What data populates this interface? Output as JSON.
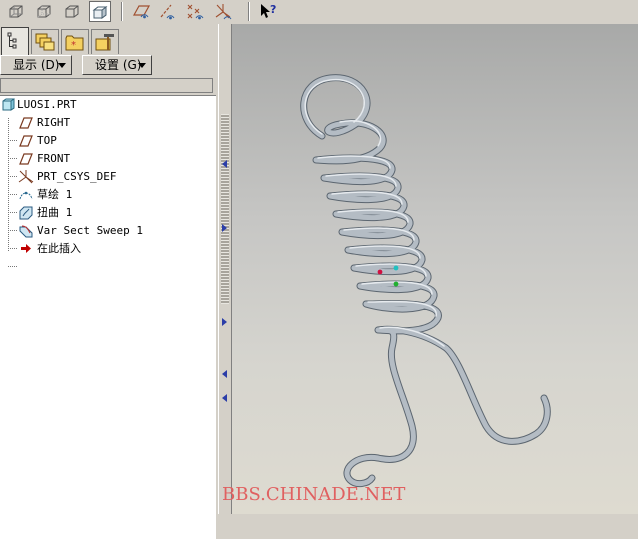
{
  "toolbar": {
    "buttons": [
      "wireframe-view",
      "hidden-line-view",
      "no-hidden-view",
      "shaded-view",
      "datum-plane-toggle",
      "datum-axis-toggle",
      "datum-point-toggle",
      "coord-sys-toggle",
      "context-help"
    ]
  },
  "panel": {
    "tabs": [
      "model-tree",
      "layers",
      "favorites",
      "tools"
    ],
    "show_menu": "显示 (D)",
    "settings_menu": "设置 (G)"
  },
  "tree": {
    "root": "LUOSI.PRT",
    "items": [
      {
        "label": "RIGHT",
        "icon": "datum-plane-icon"
      },
      {
        "label": "TOP",
        "icon": "datum-plane-icon"
      },
      {
        "label": "FRONT",
        "icon": "datum-plane-icon"
      },
      {
        "label": "PRT_CSYS_DEF",
        "icon": "coordinate-system-icon"
      },
      {
        "label": "草绘 1",
        "icon": "sketch-icon"
      },
      {
        "label": "扭曲 1",
        "icon": "warp-icon"
      },
      {
        "label": "Var Sect Sweep 1",
        "icon": "sweep-icon"
      },
      {
        "label": "在此插入",
        "icon": "insert-here-arrow-icon"
      }
    ]
  },
  "viewport": {
    "watermark": "BBS.CHINADE.NET"
  },
  "colors": {
    "spring": "#b4bcc4",
    "insert_arrow": "#c00000",
    "watermark": "#e06060"
  }
}
